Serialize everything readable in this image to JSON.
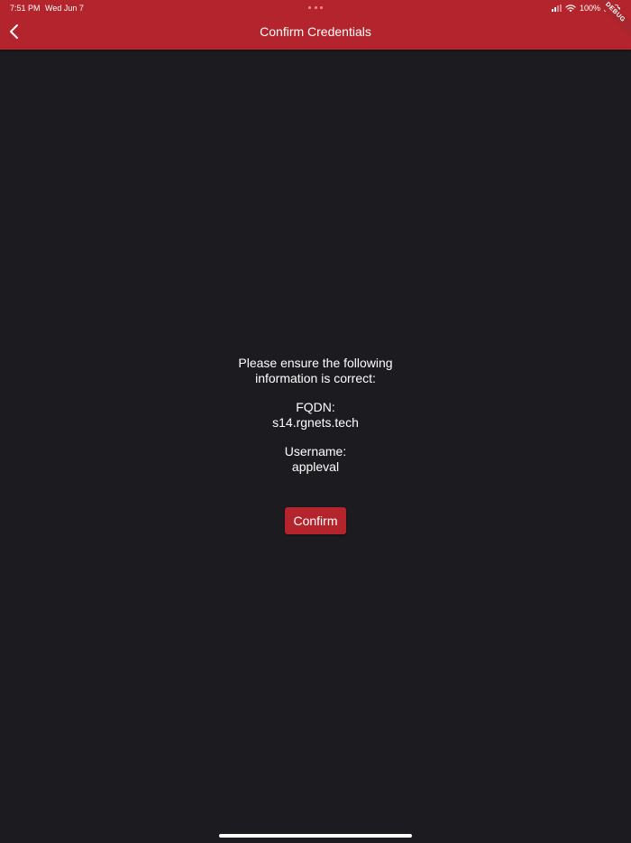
{
  "status_bar": {
    "time": "7:51 PM",
    "date": "Wed Jun 7",
    "battery": "100%"
  },
  "header": {
    "title": "Confirm Credentials",
    "debug_banner": "DEBUG"
  },
  "content": {
    "intro_line1": "Please ensure the following",
    "intro_line2": "information is correct:",
    "fqdn_label": "FQDN:",
    "fqdn_value": "s14.rgnets.tech",
    "username_label": "Username:",
    "username_value": "appleval",
    "confirm_label": "Confirm"
  },
  "colors": {
    "accent": "#b3242c",
    "background": "#1c1c20",
    "text": "#ffffff"
  },
  "icons": {
    "back": "chevron-left-icon",
    "wifi": "wifi-icon",
    "battery": "battery-icon",
    "signal": "signal-icon"
  }
}
